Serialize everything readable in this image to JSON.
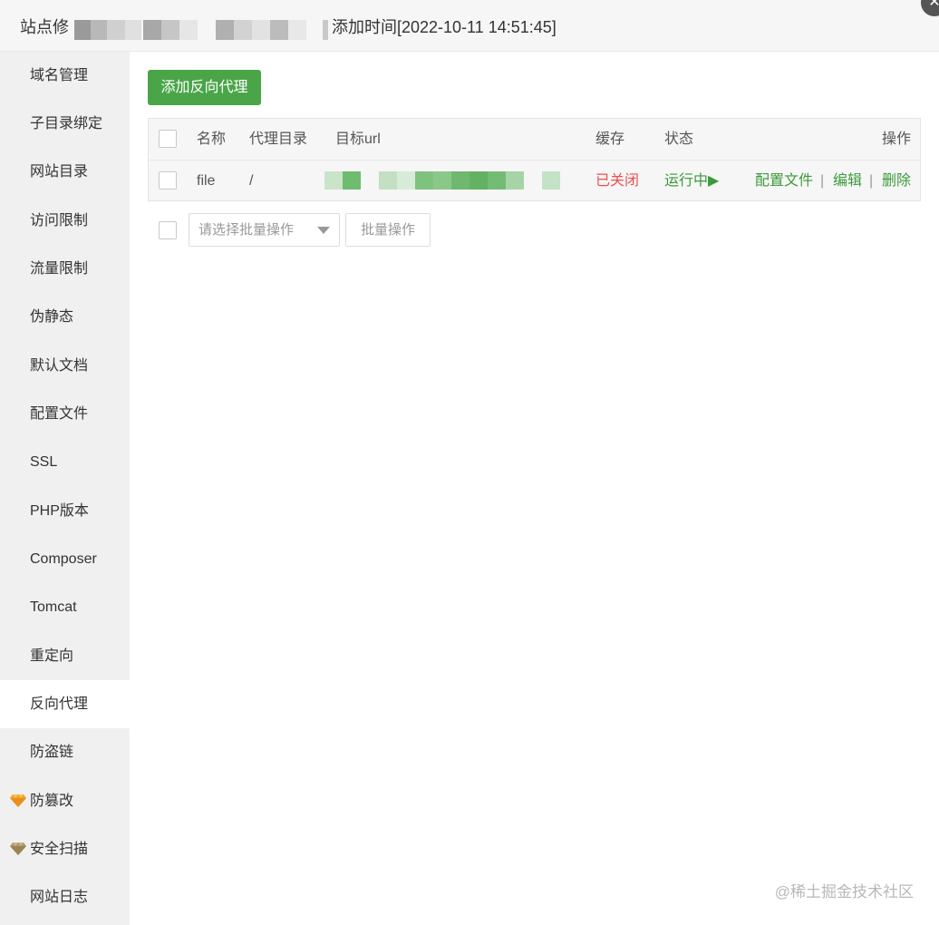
{
  "titlebar": {
    "site_prefix": "站点修",
    "added_time": "添加时间[2022-10-11 14:51:45]",
    "close_glyph": "✕"
  },
  "sidebar": {
    "items": [
      {
        "label": "域名管理"
      },
      {
        "label": "子目录绑定"
      },
      {
        "label": "网站目录"
      },
      {
        "label": "访问限制"
      },
      {
        "label": "流量限制"
      },
      {
        "label": "伪静态"
      },
      {
        "label": "默认文档"
      },
      {
        "label": "配置文件"
      },
      {
        "label": "SSL"
      },
      {
        "label": "PHP版本"
      },
      {
        "label": "Composer"
      },
      {
        "label": "Tomcat"
      },
      {
        "label": "重定向"
      },
      {
        "label": "反向代理",
        "active": true
      },
      {
        "label": "防盗链"
      },
      {
        "label": "防篡改",
        "icon": "gem-icon"
      },
      {
        "label": "安全扫描",
        "icon": "gem-icon"
      },
      {
        "label": "网站日志"
      }
    ]
  },
  "toolbar": {
    "add_label": "添加反向代理"
  },
  "table": {
    "headers": {
      "name": "名称",
      "proxy_dir": "代理目录",
      "target_url": "目标url",
      "cache": "缓存",
      "status": "状态",
      "actions": "操作"
    },
    "rows": [
      {
        "name": "file",
        "proxy_dir": "/",
        "cache": "已关闭",
        "status": "运行中▶",
        "action_config": "配置文件",
        "action_edit": "编辑",
        "action_delete": "删除",
        "separator": "|"
      }
    ]
  },
  "batch": {
    "select_placeholder": "请选择批量操作",
    "button_label": "批量操作"
  },
  "watermark": "@稀土掘金技术社区",
  "colors": {
    "accent_green": "#4aa548",
    "status_red": "#ef4f4f",
    "link_green": "#3c9a3c"
  }
}
